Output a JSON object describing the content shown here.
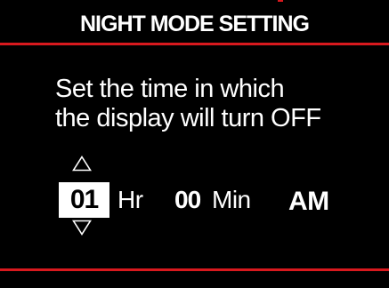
{
  "header": {
    "title": "NIGHT MODE SETTING"
  },
  "instruction": {
    "line1": "Set the time in which",
    "line2": "the display will turn OFF"
  },
  "time": {
    "hour": "01",
    "hour_unit": "Hr",
    "minute": "00",
    "minute_unit": "Min",
    "period": "AM"
  },
  "icons": {
    "up": "triangle-up-icon",
    "down": "triangle-down-icon"
  },
  "colors": {
    "background": "#000000",
    "accent": "#d8191e",
    "text": "#ffffff",
    "selected_bg": "#ffffff",
    "selected_text": "#000000"
  }
}
